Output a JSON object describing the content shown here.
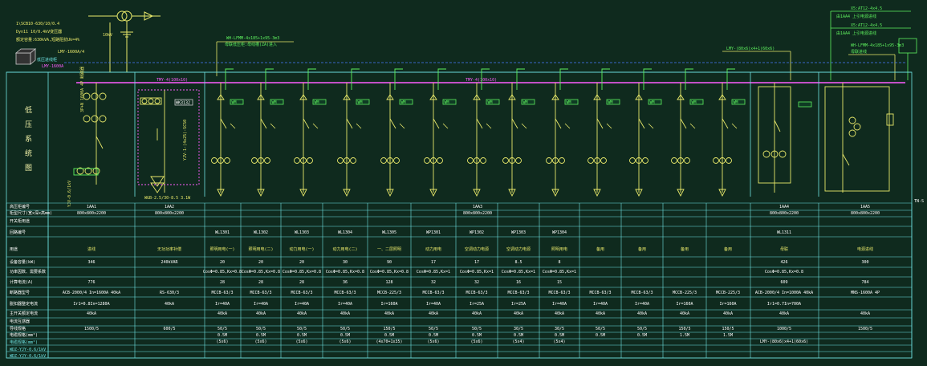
{
  "header_notes": {
    "line1": "1\\SCB10-630/10/0.4",
    "line2": "Dyn11  10/0.4kV变压器",
    "line3": "额定容量:630kVA,短路阻抗Uk=4%",
    "incoming_label": "LMY-1600A/4",
    "transformer_label": "10kV",
    "busbar_label": "LMY-1600A",
    "cabinet_label": "低压进线柜"
  },
  "top_right": {
    "l1": "X5:AT12-4x4.5",
    "l2": "由1AA4  上引电源进线",
    "l3": "X5:AT12-4x4.5",
    "l4": "由1AA4  上引电源进线"
  },
  "cable_note_left": {
    "l1": "WH-LFMM-4x185+1x95-3m3",
    "l2": "母联低压柜:母线槽(ZA)进入"
  },
  "cable_note_right": {
    "l1": "LMY-(80x6)x4+1(60x6)",
    "l2": "WH-LFMM-4x185+1x95-3m3",
    "l3": "母联进线"
  },
  "bus_labels": {
    "main": "TMY-4(100x10)",
    "mid": "TMY-4(100x10)"
  },
  "vertical_title": [
    "低",
    "压",
    "系",
    "统",
    "图"
  ],
  "feeder_tag": "WM",
  "ground_label": "TN-S",
  "breaker_box_label": "WK3132",
  "left_vertical_note": "3P+N 1600A 4P 断路器",
  "mid_vertical_note": "YJV-1-(4x25)-SC50",
  "left_bottom_note": "YJV-0.6/1kV",
  "mid_bottom_note": "WGB-2.5/30-8.5  3.1W",
  "table": {
    "row_labels": [
      "高压柜编号",
      "柜型尺寸(宽x深x高mm)",
      "开关柜用途",
      "回路编号",
      "用途",
      "设备容量(kW)",
      "功率因数、需要系数",
      "计算电流(A)",
      "断路器型号",
      "脱扣器整定电流",
      "主开关额定电流",
      "电流互感器",
      "导线规格",
      "电缆规格(mm²)"
    ],
    "cabinet_no": [
      "1AA1",
      "1AA2",
      "1AA3",
      "1AA4",
      "1AA5"
    ],
    "cabinet_size": [
      "800x800x2200",
      "800x800x2200",
      "800x800x2200",
      "800x800x2200",
      "800x800x2200"
    ],
    "circuits": [
      "WL1301",
      "WL1302",
      "WL1303",
      "WL1304",
      "WL1305",
      "WP1301",
      "WP1302",
      "WP1303",
      "WP1304",
      "",
      "",
      "",
      "",
      "WL1311",
      ""
    ],
    "usage": [
      "进线",
      "无功功率补偿",
      "照明用电(一)",
      "照明用电(二)",
      "动力用电(一)",
      "动力用电(二)",
      "一、二层照明",
      "动力用电",
      "空调动力电源",
      "空调动力电源",
      "照明用电",
      "备用",
      "备用",
      "备用",
      "备用",
      "母联",
      "电源进线"
    ],
    "capacity": [
      "346",
      "240kVAR",
      "20",
      "20",
      "20",
      "30",
      "90",
      "17",
      "17",
      "8.5",
      "8",
      "426",
      "300"
    ],
    "pf": [
      "",
      "",
      "CosΦ=0.85,Kx=0.8",
      "CosΦ=0.85,Kx=0.8",
      "CosΦ=0.85,Kx=0.8",
      "CosΦ=0.85,Kx=0.8",
      "CosΦ=0.85,Kx=0.8",
      "CosΦ=0.85,Kx=1",
      "CosΦ=0.85,Kx=1",
      "CosΦ=0.85,Kx=1",
      "CosΦ=0.85,Kx=1",
      "CosΦ=0.85,Kx=0.8",
      ""
    ],
    "current": [
      "776",
      "",
      "28",
      "28",
      "28",
      "36",
      "128",
      "32",
      "32",
      "16",
      "15",
      "609",
      "784"
    ],
    "breaker": [
      "ACB-2000/4  In=1600A  40kA",
      "RS-630/3",
      "MCCB-63/3",
      "MCCB-63/3",
      "MCCB-63/3",
      "MCCB-63/3",
      "MCCB-225/3",
      "MCCB-63/3",
      "MCCB-63/3",
      "MCCB-63/3",
      "MCCB-63/3",
      "MCCB-63/3",
      "MCCB-63/3",
      "MCCB-225/3",
      "MCCB-225/3",
      "ACB-2000/4  In=1000A  40kA",
      "MNS-1600A 4P"
    ],
    "breaker_setting": [
      "Ir1=0.8In=1280A",
      "40kA",
      "Ir=40A",
      "Ir=40A",
      "Ir=40A",
      "Ir=40A",
      "Ir=160A",
      "Ir=40A",
      "Ir=25A",
      "Ir=25A",
      "Ir=40A",
      "Ir=40A",
      "Ir=40A",
      "Ir=160A",
      "Ir=160A",
      "Ir1=0.7In=700A",
      ""
    ],
    "main_current": [
      "40kA",
      "",
      "40kA",
      "40kA",
      "40kA",
      "40kA",
      "40kA",
      "40kA",
      "40kA",
      "40kA",
      "40kA",
      "40kA",
      "40kA",
      "40kA",
      "40kA",
      "40kA",
      "40kA"
    ],
    "ct": [
      "1500/5",
      "600/5",
      "50/5",
      "50/5",
      "50/5",
      "50/5",
      "150/5",
      "50/5",
      "50/5",
      "30/5",
      "30/5",
      "50/5",
      "50/5",
      "150/5",
      "150/5",
      "1000/5",
      "1500/5"
    ],
    "wire": [
      "",
      "",
      "0.5M",
      "0.5M",
      "0.5M",
      "0.5M",
      "0.5M",
      "0.5M",
      "0.5M",
      "0.5M",
      "0.5M",
      "0.5M",
      "0.5M",
      "1.5M",
      "1.5M",
      "",
      ""
    ],
    "cable": [
      "",
      "",
      "(5x6)",
      "(5x6)",
      "(5x6)",
      "(5x6)",
      "(4x70+1x35)",
      "(5x6)",
      "(5x6)",
      "(5x4)",
      "(5x4)",
      "",
      "",
      "",
      "",
      "LMY-(80x6)x4+1(60x6)",
      ""
    ]
  },
  "bottom_left_notes": [
    "电缆规格(mm²)",
    "WDZ-YJY-0.6/1kV",
    "WDZ-YJY-0.6/1kV"
  ]
}
